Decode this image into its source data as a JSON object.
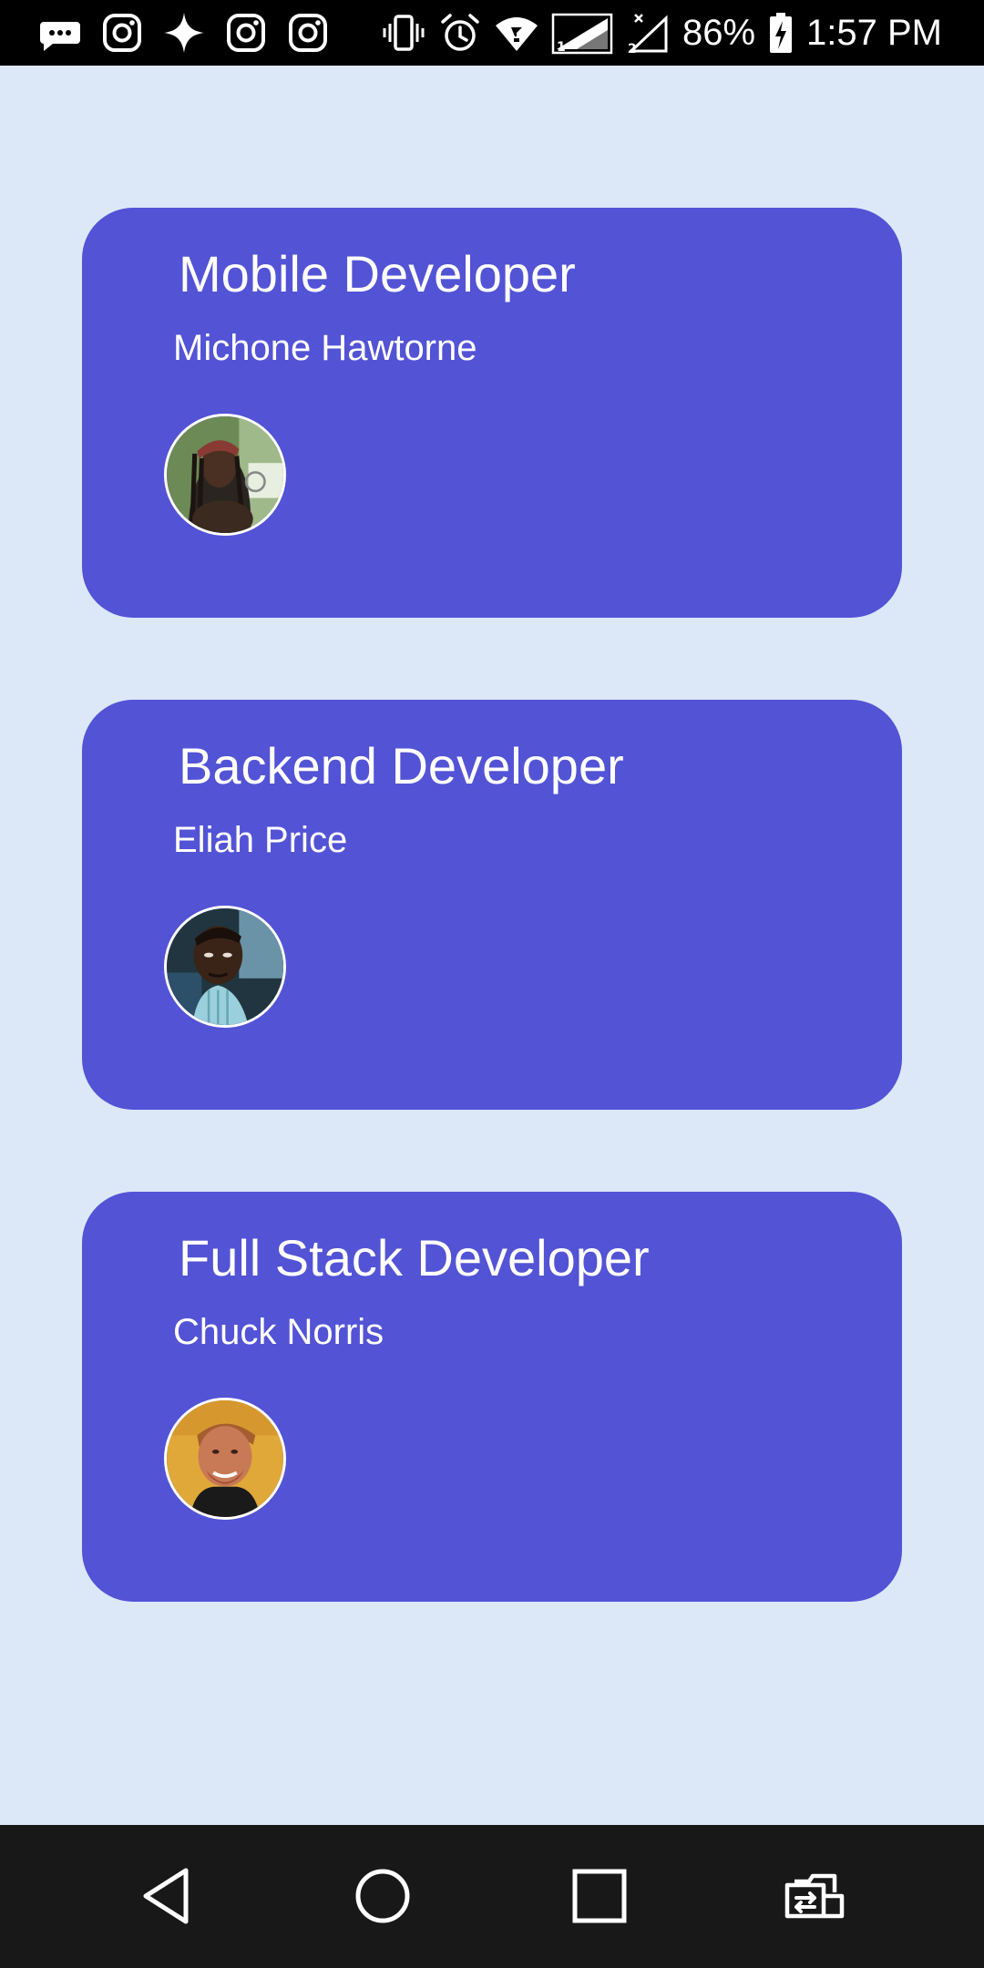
{
  "status_bar": {
    "battery": "86%",
    "time": "1:57 PM",
    "left_icons": [
      "messages-icon",
      "instagram-icon",
      "spark-icon",
      "instagram-icon",
      "instagram-icon"
    ],
    "right_icons": [
      "vibrate-icon",
      "alarm-icon",
      "wifi-icon",
      "signal-sim1-icon",
      "signal-sim2-icon",
      "battery-charging-icon"
    ]
  },
  "cards": [
    {
      "title": "Mobile Developer",
      "name": "Michone Hawtorne"
    },
    {
      "title": "Backend Developer",
      "name": "Eliah Price"
    },
    {
      "title": "Full Stack Developer",
      "name": "Chuck Norris"
    }
  ],
  "nav_bar": {
    "buttons": [
      "back-icon",
      "home-icon",
      "recents-icon",
      "switch-app-icon"
    ]
  },
  "colors": {
    "background": "#dce8f8",
    "card": "#5353d6",
    "card_text": "#ffffff",
    "status_bar": "#000000",
    "nav_bar": "#181818"
  }
}
